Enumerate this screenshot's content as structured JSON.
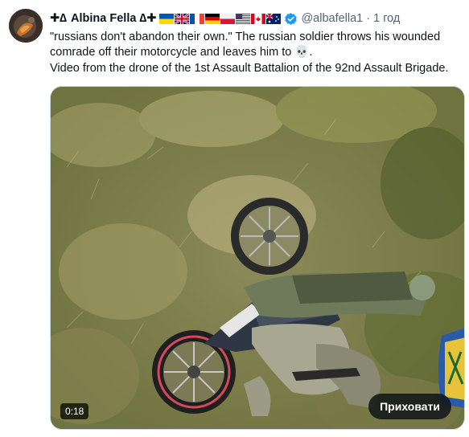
{
  "author": {
    "display_name": "Albina Fella",
    "name_prefix_symbols": "✚∆",
    "name_suffix_symbols": "∆✚",
    "handle": "@albafella1",
    "separator": "·",
    "timestamp": "1 год",
    "verified": true
  },
  "tweet": {
    "text_line_1": "\"russians don't abandon their own.\" The russian soldier throws his wounded",
    "text_line_2": "comrade off their motorcycle and leaves him to",
    "text_line_2_emoji": "💀",
    "text_line_2_end": ".",
    "text_line_3": "Video from the drone of the 1st Assault Battalion of the 92nd Assault Brigade."
  },
  "media": {
    "duration": "0:18",
    "hide_button_label": "Приховати"
  },
  "colors": {
    "text": "#0f1419",
    "secondary": "#536471",
    "verified_blue": "#1d9bf0",
    "grass_dark": "#5e6b35",
    "grass_light": "#b8b27a"
  },
  "icons": {
    "verified": "verified-badge-icon",
    "more": "more-icon"
  }
}
